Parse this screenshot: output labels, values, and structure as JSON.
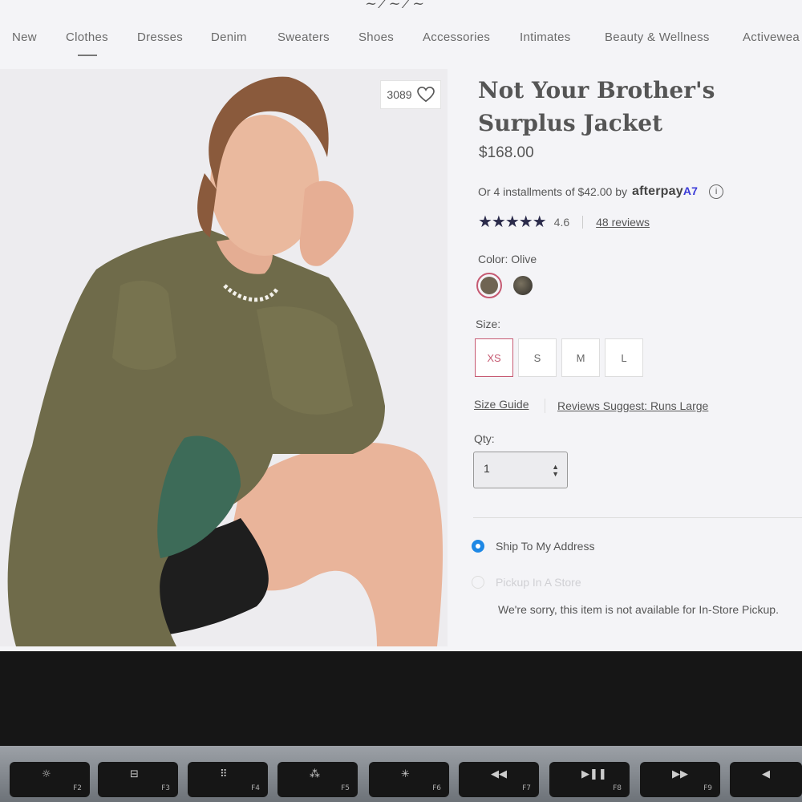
{
  "nav": {
    "items": [
      "New",
      "Clothes",
      "Dresses",
      "Denim",
      "Sweaters",
      "Shoes",
      "Accessories",
      "Intimates",
      "Beauty & Wellness",
      "Activewea"
    ]
  },
  "product": {
    "wishlist_count": "3089",
    "title": "Not Your Brother's Surplus Jacket",
    "price": "$168.00",
    "installments_text": "Or 4 installments of $42.00 by",
    "afterpay_brand": "afterpay",
    "afterpay_mark": "A7",
    "rating_stars": "★★★★★",
    "rating_value": "4.6",
    "reviews_link": "48 reviews",
    "color_label": "Color: Olive",
    "size_label": "Size:",
    "sizes": [
      "XS",
      "S",
      "M",
      "L"
    ],
    "selected_size": "XS",
    "size_guide": "Size Guide",
    "fit_note": "Reviews Suggest: Runs Large",
    "qty_label": "Qty:",
    "qty_value": "1",
    "ship_option": "Ship To My Address",
    "pickup_option": "Pickup In A Store",
    "pickup_notice": "We're sorry, this item is not available for In-Store Pickup."
  },
  "colors": {
    "accent": "#c65a72",
    "radio": "#1e88e5",
    "swatch_olive": "#6f6452"
  },
  "keyboard": {
    "keys": [
      {
        "icon": "brightness-up-icon",
        "glyph": "☼",
        "fn": "F2"
      },
      {
        "icon": "mission-control-icon",
        "glyph": "⊟",
        "fn": "F3"
      },
      {
        "icon": "launchpad-icon",
        "glyph": "⠿",
        "fn": "F4"
      },
      {
        "icon": "keyboard-light-down-icon",
        "glyph": "⁂",
        "fn": "F5"
      },
      {
        "icon": "keyboard-light-up-icon",
        "glyph": "✳",
        "fn": "F6"
      },
      {
        "icon": "rewind-icon",
        "glyph": "◀◀",
        "fn": "F7"
      },
      {
        "icon": "play-pause-icon",
        "glyph": "▶❚❚",
        "fn": "F8"
      },
      {
        "icon": "fast-forward-icon",
        "glyph": "▶▶",
        "fn": "F9"
      },
      {
        "icon": "mute-icon",
        "glyph": "◀",
        "fn": ""
      }
    ]
  }
}
